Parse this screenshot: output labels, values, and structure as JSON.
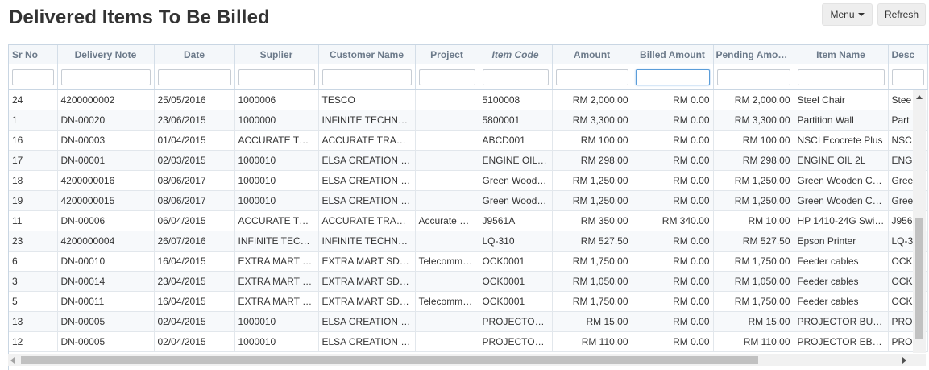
{
  "page": {
    "title": "Delivered Items To Be Billed"
  },
  "toolbar": {
    "menu_label": "Menu",
    "refresh_label": "Refresh"
  },
  "columns": [
    {
      "label": "Sr No"
    },
    {
      "label": "Delivery Note"
    },
    {
      "label": "Date"
    },
    {
      "label": "Suplier"
    },
    {
      "label": "Customer Name"
    },
    {
      "label": "Project"
    },
    {
      "label": "Item Code"
    },
    {
      "label": "Amount"
    },
    {
      "label": "Billed Amount"
    },
    {
      "label": "Pending Amou..."
    },
    {
      "label": "Item Name"
    },
    {
      "label": "Desc"
    }
  ],
  "rows": [
    [
      "24",
      "4200000002",
      "25/05/2016",
      "1000006",
      "TESCO",
      "",
      "5100008",
      "RM 2,000.00",
      "RM 0.00",
      "RM 2,000.00",
      "Steel Chair",
      "Stee"
    ],
    [
      "1",
      "DN-00020",
      "23/06/2015",
      "1000000",
      "INFINITE TECHNOL...",
      "",
      "5800001",
      "RM 3,300.00",
      "RM 0.00",
      "RM 3,300.00",
      "Partition Wall",
      "Part"
    ],
    [
      "16",
      "DN-00003",
      "01/04/2015",
      "ACCURATE TRA...",
      "ACCURATE TRADIN...",
      "",
      "ABCD001",
      "RM 100.00",
      "RM 0.00",
      "RM 100.00",
      "NSCI Ecocrete Plus",
      "NSC"
    ],
    [
      "17",
      "DN-00001",
      "02/03/2015",
      "1000010",
      "ELSA CREATION SD...",
      "",
      "ENGINE OIL 2L",
      "RM 298.00",
      "RM 0.00",
      "RM 298.00",
      "ENGINE OIL 2L",
      "ENG"
    ],
    [
      "18",
      "4200000016",
      "08/06/2017",
      "1000010",
      "ELSA CREATION SD...",
      "",
      "Green Woode...",
      "RM 1,250.00",
      "RM 0.00",
      "RM 1,250.00",
      "Green Wooden Cha...",
      "Gree"
    ],
    [
      "19",
      "4200000015",
      "08/06/2017",
      "1000010",
      "ELSA CREATION SD...",
      "",
      "Green Woode...",
      "RM 1,250.00",
      "RM 0.00",
      "RM 1,250.00",
      "Green Wooden Cha...",
      "Gree"
    ],
    [
      "11",
      "DN-00006",
      "06/04/2015",
      "ACCURATE TRA...",
      "ACCURATE TRADIN...",
      "Accurate ER...",
      "J9561A",
      "RM 350.00",
      "RM 340.00",
      "RM 10.00",
      "HP 1410-24G Switch",
      "J956"
    ],
    [
      "23",
      "4200000004",
      "26/07/2016",
      "INFINITE TECHN...",
      "INFINITE TECHNOL...",
      "",
      "LQ-310",
      "RM 527.50",
      "RM 0.00",
      "RM 527.50",
      "Epson Printer",
      "LQ-3"
    ],
    [
      "6",
      "DN-00010",
      "16/04/2015",
      "EXTRA MART SD...",
      "EXTRA MART SDN ...",
      "Telecommu...",
      "OCK0001",
      "RM 1,750.00",
      "RM 0.00",
      "RM 1,750.00",
      "Feeder cables",
      "OCK"
    ],
    [
      "3",
      "DN-00014",
      "23/04/2015",
      "EXTRA MART SD...",
      "EXTRA MART SDN ...",
      "",
      "OCK0001",
      "RM 1,050.00",
      "RM 0.00",
      "RM 1,050.00",
      "Feeder cables",
      "OCK"
    ],
    [
      "5",
      "DN-00011",
      "16/04/2015",
      "EXTRA MART SD...",
      "EXTRA MART SDN ...",
      "Telecommu...",
      "OCK0001",
      "RM 1,750.00",
      "RM 0.00",
      "RM 1,750.00",
      "Feeder cables",
      "OCK"
    ],
    [
      "13",
      "DN-00005",
      "02/04/2015",
      "1000010",
      "ELSA CREATION SD...",
      "",
      "PROJECTOR B...",
      "RM 15.00",
      "RM 0.00",
      "RM 15.00",
      "PROJECTOR BULB",
      "PRO"
    ],
    [
      "12",
      "DN-00005",
      "02/04/2015",
      "1000010",
      "ELSA CREATION SD...",
      "",
      "PROJECTOR E...",
      "RM 110.00",
      "RM 0.00",
      "RM 110.00",
      "PROJECTOR EB-W28",
      "PRO"
    ]
  ]
}
